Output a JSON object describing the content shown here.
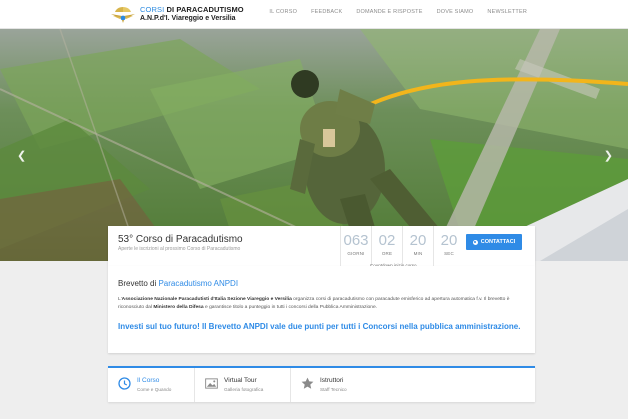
{
  "brand": {
    "line1_accent": "CORSI",
    "line1_rest": " DI PARACADUTISMO",
    "line2": "A.N.P.d'I. Viareggio e Versilia",
    "logo_icon": "parachute-wings-icon"
  },
  "nav": {
    "items": [
      {
        "label": "IL CORSO"
      },
      {
        "label": "FEEDBACK"
      },
      {
        "label": "DOMANDE E RISPOSTE"
      },
      {
        "label": "DOVE SIAMO"
      },
      {
        "label": "NEWSLETTER"
      }
    ]
  },
  "hero": {
    "prev_icon": "chevron-left-icon",
    "next_icon": "chevron-right-icon"
  },
  "course": {
    "title": "53° Corso di Paracadutismo",
    "subtitle": "Aperte le iscrizioni al prossimo Corso di Paracadutismo",
    "countdown": [
      {
        "value": "063",
        "label": "GIORNI"
      },
      {
        "value": "02",
        "label": "ORE"
      },
      {
        "value": "20",
        "label": "MIN"
      },
      {
        "value": "20",
        "label": "SEC"
      }
    ],
    "countdown_caption": "Countdown inizio corso",
    "contact_label": "CONTATTACI"
  },
  "intro": {
    "heading_plain": "Brevetto di ",
    "heading_accent": "Paracadutismo ANPDI",
    "body_1": "L'",
    "body_bold_1": "Associazione Nazionale Paracadutisti d'Italia Sezione Viareggio e Versilia",
    "body_2": " organizza corsi di paracadutismo con paracadute emisferico ad apertura automatica f.v. Il brevetto è riconosciuto dal ",
    "body_bold_2": "Ministero della Difesa",
    "body_3": " e garantisce titolo a punteggio in tutti i concorsi della Pubblica Amministrazione.",
    "cta": "Investi sul tuo futuro! Il Brevetto ANPDI vale due punti per tutti i Concorsi nella pubblica amministrazione."
  },
  "tabs": [
    {
      "title": "Il Corso",
      "subtitle": "Come e Quando",
      "icon": "clock-icon"
    },
    {
      "title": "Virtual Tour",
      "subtitle": "Galleria fotografica",
      "icon": "image-icon"
    },
    {
      "title": "Istruttori",
      "subtitle": "Staff Tecnico",
      "icon": "star-icon"
    }
  ],
  "colors": {
    "accent": "#2f8be6",
    "countdown_digits": "#b5c3d0"
  }
}
